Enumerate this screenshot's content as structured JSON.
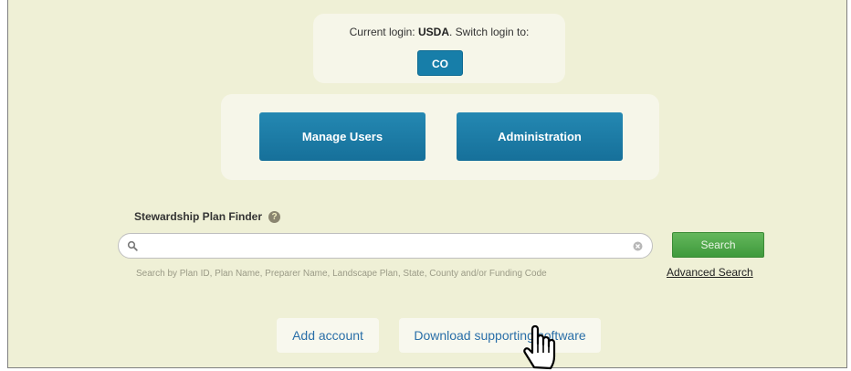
{
  "login": {
    "prefix": "Current login: ",
    "user": "USDA",
    "suffix": ". Switch login to:",
    "switch_button": "CO"
  },
  "actions": {
    "manage_users": "Manage Users",
    "administration": "Administration"
  },
  "finder": {
    "title": "Stewardship Plan Finder",
    "help": "?",
    "search_value": "",
    "search_button": "Search",
    "hint": "Search by Plan ID, Plan Name, Preparer Name, Landscape Plan, State, County and/or Funding Code",
    "advanced_link": "Advanced Search"
  },
  "footer_links": {
    "add_account": "Add account",
    "download_software": "Download supporting software"
  },
  "colors": {
    "background": "#eff0d6",
    "panel": "#f6f6e9",
    "primary_button": "#177ea9",
    "search_button": "#4fa84a",
    "link": "#2a6fa8"
  },
  "icons": [
    "search-icon",
    "clear-icon",
    "help-icon",
    "hand-cursor-icon"
  ]
}
